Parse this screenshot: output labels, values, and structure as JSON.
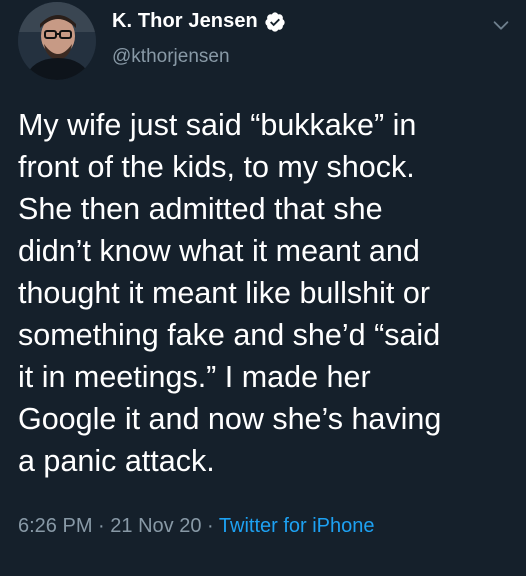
{
  "author": {
    "display_name": "K. Thor Jensen",
    "handle": "@kthorjensen",
    "verified_icon": "verified-badge-icon",
    "avatar_icon": "avatar-photo"
  },
  "menu": {
    "icon": "chevron-down-icon"
  },
  "tweet": {
    "lines": [
      "My wife just said “bukkake” in",
      "front of the kids, to my shock.",
      "She then admitted that she",
      "didn’t know what it meant and",
      "thought it meant like bullshit or",
      "something fake and she’d “said",
      "it in meetings.” I made her",
      "Google it and now she’s having",
      "a panic attack."
    ]
  },
  "meta": {
    "time": "6:26 PM",
    "separator": "·",
    "date": "21 Nov 20",
    "source": "Twitter for iPhone"
  },
  "colors": {
    "background": "#15202b",
    "text": "#ffffff",
    "muted": "#8899a6",
    "link": "#1da1f2"
  }
}
